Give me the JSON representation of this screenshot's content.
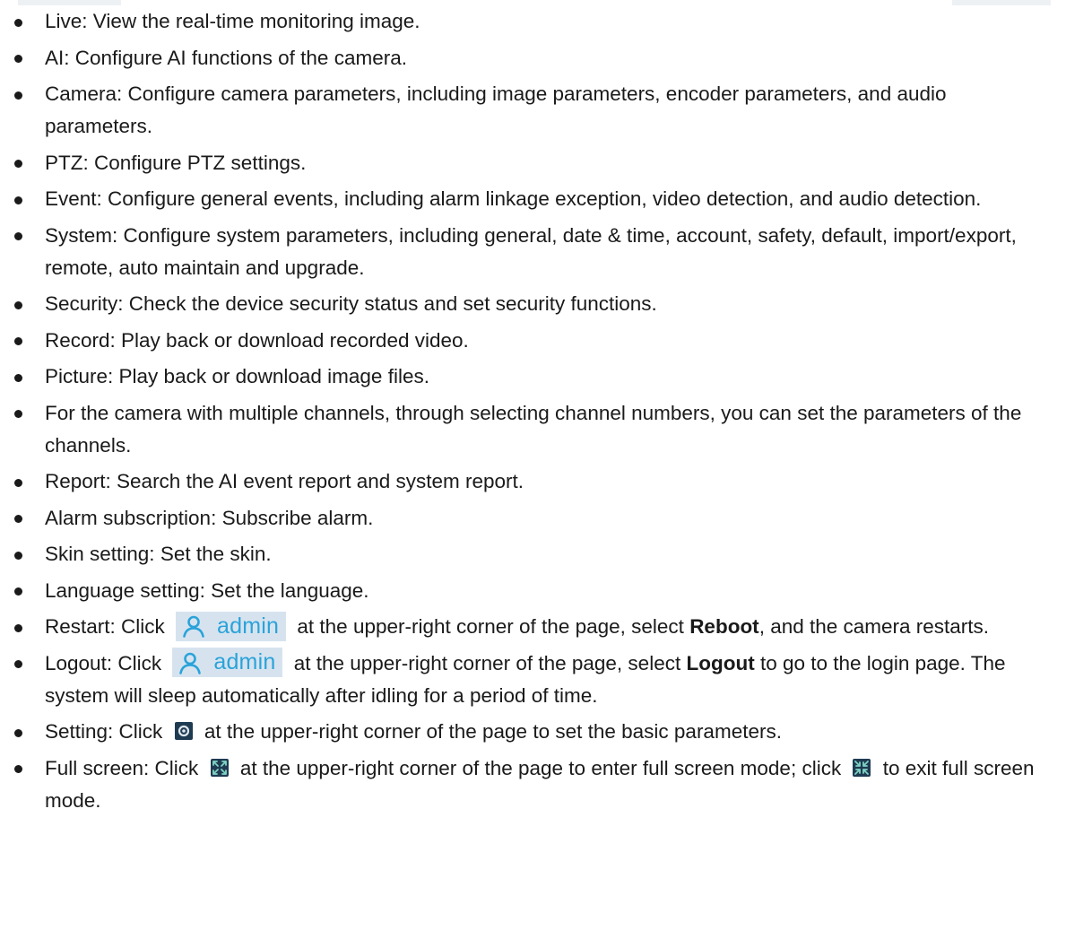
{
  "items": [
    {
      "text": "Live: View the real-time monitoring image."
    },
    {
      "text": "AI: Configure AI functions of the camera."
    },
    {
      "text": "Camera: Configure camera parameters, including image parameters, encoder parameters, and audio parameters."
    },
    {
      "text": "PTZ: Configure PTZ settings."
    },
    {
      "text": "Event: Configure general events, including alarm linkage exception, video detection, and audio detection."
    },
    {
      "text": "System: Configure system parameters, including general, date & time, account, safety, default, import/export, remote, auto maintain and upgrade."
    },
    {
      "text": "Security: Check the device security status and set security functions."
    },
    {
      "text": "Record: Play back or download recorded video."
    },
    {
      "text": "Picture: Play back or download image files."
    },
    {
      "text": "For the camera with multiple channels, through selecting channel numbers, you can set the parameters of the channels."
    },
    {
      "text": "Report: Search the AI event report and system report."
    },
    {
      "text": "Alarm subscription: Subscribe alarm."
    },
    {
      "text": "Skin setting: Set the skin."
    },
    {
      "text": "Language setting: Set the language."
    }
  ],
  "restart": {
    "prefix": "Restart: Click",
    "badge": "admin",
    "middle": "at the upper-right corner of the page, select",
    "action": "Reboot",
    "suffix": ", and the camera restarts."
  },
  "logout": {
    "prefix": "Logout: Click",
    "badge": "admin",
    "middle": "at the upper-right corner of the page, select",
    "action": "Logout",
    "suffix": "to go to the login page. The system will sleep automatically after idling for a period of time."
  },
  "setting": {
    "prefix": "Setting: Click",
    "icon": "gear-icon",
    "suffix": "at the upper-right corner of the page to set the basic parameters."
  },
  "fullscreen": {
    "prefix": "Full screen: Click",
    "enter_icon": "enter-fullscreen-icon",
    "middle": "at the upper-right corner of the page to enter full screen mode; click",
    "exit_icon": "exit-fullscreen-icon",
    "suffix": "to exit full screen mode."
  },
  "colors": {
    "badge_background": "#d6e3ef",
    "badge_accent": "#2aa3d9",
    "icon_background": "#1f3b52"
  }
}
